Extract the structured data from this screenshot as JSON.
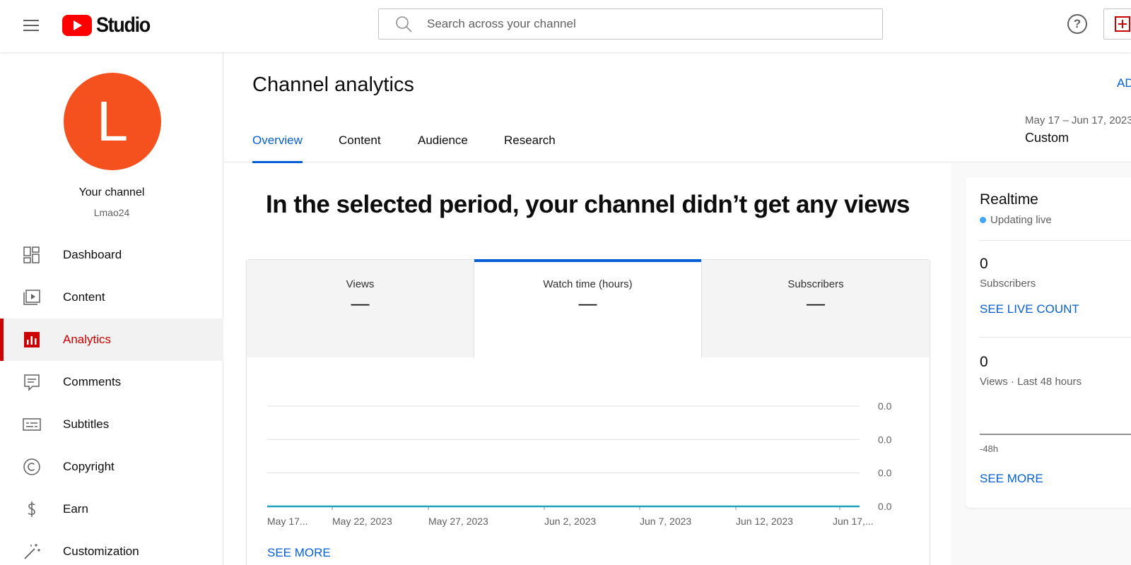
{
  "header": {
    "logo_text": "Studio",
    "search_placeholder": "Search across your channel",
    "help_label": "?"
  },
  "sidebar": {
    "avatar_letter": "L",
    "channel_title": "Your channel",
    "channel_name": "Lmao24",
    "items": [
      {
        "label": "Dashboard",
        "icon": "dashboard-icon"
      },
      {
        "label": "Content",
        "icon": "content-icon"
      },
      {
        "label": "Analytics",
        "icon": "analytics-icon",
        "active": true
      },
      {
        "label": "Comments",
        "icon": "comments-icon"
      },
      {
        "label": "Subtitles",
        "icon": "subtitles-icon"
      },
      {
        "label": "Copyright",
        "icon": "copyright-icon"
      },
      {
        "label": "Earn",
        "icon": "earn-icon"
      },
      {
        "label": "Customization",
        "icon": "customization-icon"
      }
    ]
  },
  "main": {
    "title": "Channel analytics",
    "advanced_label": "AD",
    "tabs": [
      "Overview",
      "Content",
      "Audience",
      "Research"
    ],
    "active_tab": "Overview",
    "date_range": "May 17 – Jun 17, 2023",
    "date_type": "Custom",
    "headline": "In the selected period, your channel didn’t get any views",
    "metrics": [
      {
        "label": "Views",
        "value": "—"
      },
      {
        "label": "Watch time (hours)",
        "value": "—",
        "active": true
      },
      {
        "label": "Subscribers",
        "value": "—"
      }
    ],
    "see_more": "SEE MORE"
  },
  "chart_data": {
    "type": "line",
    "x": [
      "May 17...",
      "May 22, 2023",
      "May 27, 2023",
      "Jun 2, 2023",
      "Jun 7, 2023",
      "Jun 12, 2023",
      "Jun 17,..."
    ],
    "series": [
      {
        "values": [
          0,
          0,
          0,
          0,
          0,
          0,
          0
        ]
      }
    ],
    "y_ticks": [
      "0.0",
      "0.0",
      "0.0",
      "0.0"
    ],
    "ylim": [
      0,
      0
    ],
    "grid": true,
    "line_color": "#1ea0b8"
  },
  "realtime": {
    "title": "Realtime",
    "status": "Updating live",
    "subscribers_value": "0",
    "subscribers_label": "Subscribers",
    "see_live_count": "SEE LIVE COUNT",
    "views_value": "0",
    "views_label": "Views · Last 48 hours",
    "axis_label": "-48h",
    "see_more": "SEE MORE"
  },
  "colors": {
    "accent": "#065fd4",
    "brand_red": "#cc0000",
    "avatar": "#f4511e",
    "live_dot": "#3ea6ff"
  }
}
